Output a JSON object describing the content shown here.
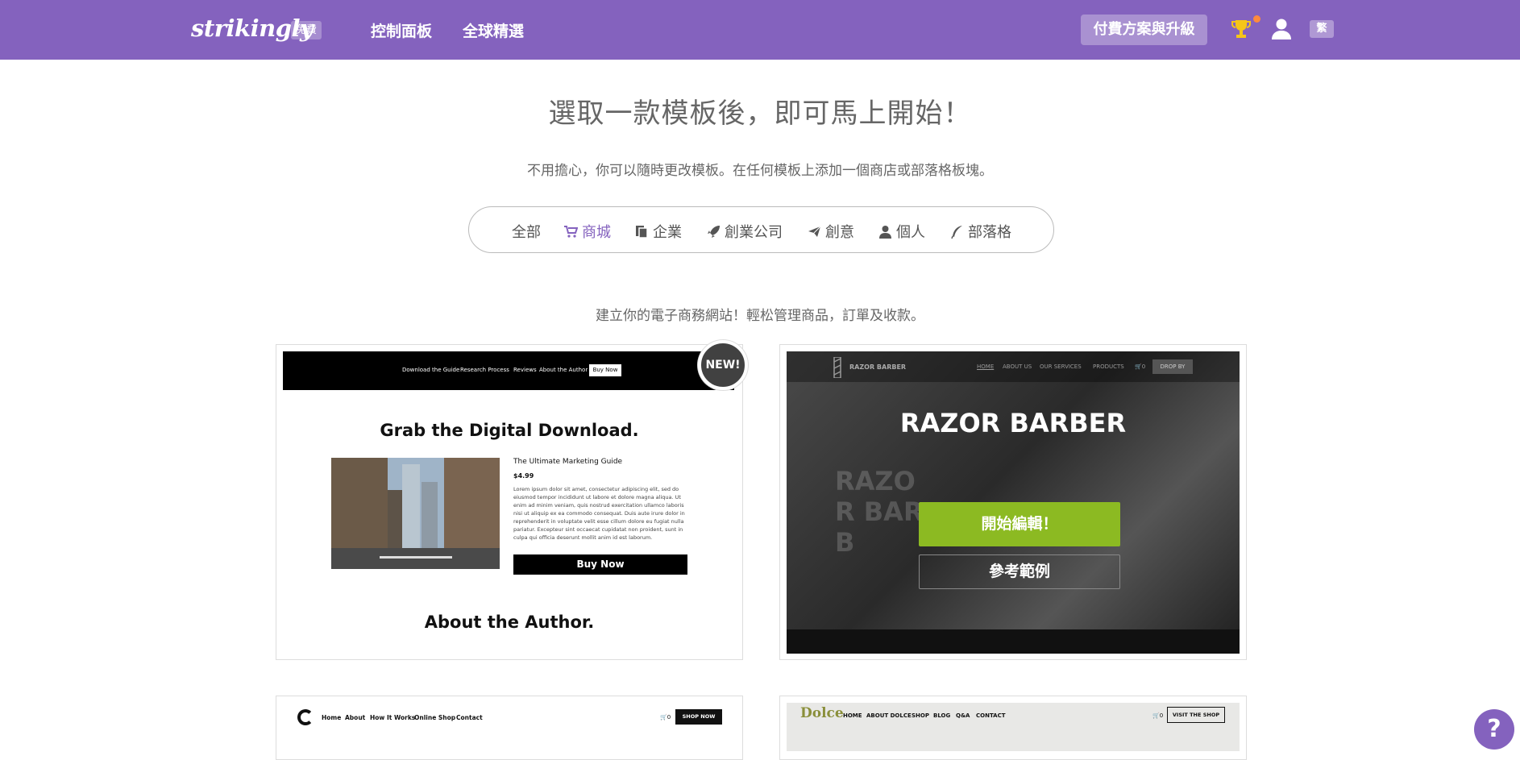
{
  "topbar": {
    "logo": "strikingly",
    "plan_badge": "免費",
    "nav": [
      "控制面板",
      "全球精選"
    ],
    "upgrade_label": "付費方案與升級",
    "lang": "繁",
    "icons": [
      "trophy-icon",
      "user-icon"
    ]
  },
  "headline": "選取一款模板後，即可馬上開始！",
  "subline": "不用擔心，你可以隨時更改模板。在任何模板上添加一個商店或部落格板塊。",
  "categories": [
    {
      "label": "全部",
      "icon": ""
    },
    {
      "label": "商城",
      "icon": "cart-icon",
      "active": true
    },
    {
      "label": "企業",
      "icon": "documents-icon"
    },
    {
      "label": "創業公司",
      "icon": "rocket-icon"
    },
    {
      "label": "創意",
      "icon": "paper-plane-icon"
    },
    {
      "label": "個人",
      "icon": "person-icon"
    },
    {
      "label": "部落格",
      "icon": "quill-icon"
    }
  ],
  "store_desc": "建立你的電子商務網站！輕松管理商品，訂單及收款。",
  "templates": [
    {
      "badge": "NEW!",
      "nav": [
        "Download the Guide",
        "Research Process",
        "Reviews",
        "About the Author"
      ],
      "nav_button": "Buy Now",
      "title": "Grab the Digital Download.",
      "product": "The Ultimate Marketing Guide",
      "price": "$4.99",
      "body": "Lorem ipsum dolor sit amet, consectetur adipiscing elit, sed do eiusmod tempor incididunt ut labore et dolore magna aliqua. Ut enim ad minim veniam, quis nostrud exercitation ullamco laboris nisi ut aliquip ex ea commodo consequat. Duis aute irure dolor in reprehenderit in voluptate velit esse cillum dolore eu fugiat nulla pariatur. Excepteur sint occaecat cupidatat non proident, sunt in culpa qui officia deserunt mollit anim id est laborum.",
      "buy": "Buy Now",
      "section": "About the Author."
    },
    {
      "logo_text": "RAZOR BARBER",
      "nav": [
        "HOME",
        "ABOUT US",
        "OUR SERVICES",
        "PRODUCTS"
      ],
      "cart": "0",
      "nav_button": "DROP BY",
      "title": "RAZOR BARBER",
      "ghost_text": "RAZOR BARB",
      "edit_label": "開始編輯！",
      "preview_label": "參考範例"
    },
    {
      "nav": [
        "Home",
        "About",
        "How It Works",
        "Online Shop",
        "Contact"
      ],
      "cart": "0",
      "nav_button": "SHOP NOW"
    },
    {
      "logo": "Dolce",
      "nav": [
        "HOME",
        "ABOUT DOLCE",
        "SHOP",
        "BLOG",
        "Q&A",
        "CONTACT"
      ],
      "cart": "0",
      "nav_button": "VISIT THE SHOP"
    }
  ],
  "help_label": "?",
  "colors": {
    "brand": "#8462be",
    "edit_green": "#8cba22"
  }
}
